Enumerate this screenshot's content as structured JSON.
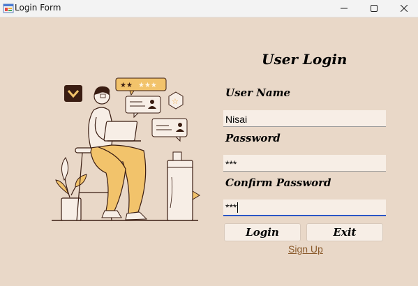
{
  "window": {
    "title": "Login Form",
    "icons": {
      "app": "app-form-icon",
      "minimize": "minimize-icon",
      "maximize": "maximize-icon",
      "close": "close-icon"
    }
  },
  "form": {
    "heading": "User Login",
    "username_label": "User Name",
    "username_value": "Nisai",
    "password_label": "Password",
    "password_value": "***",
    "confirm_label": "Confirm Password",
    "confirm_value": "***",
    "login_button": "Login",
    "exit_button": "Exit",
    "signup_link": "Sign Up"
  },
  "colors": {
    "background": "#e9d8c8",
    "input_background": "#f7eee6",
    "link": "#8a5a2b",
    "focus": "#2a56c6",
    "illustration_accent": "#f2c36b",
    "illustration_dark": "#3a1d12"
  }
}
